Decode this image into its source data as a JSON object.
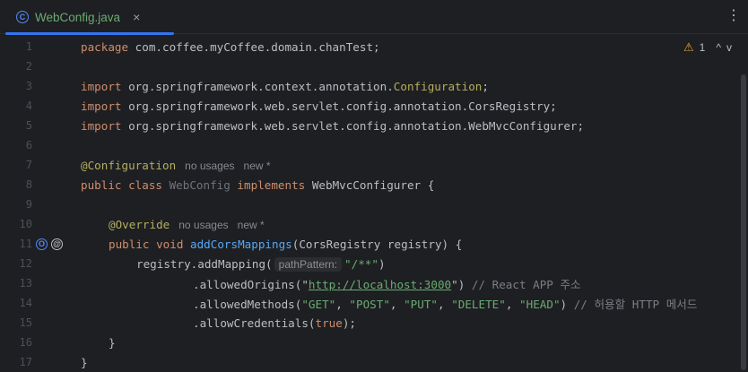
{
  "tab": {
    "title": "WebConfig.java",
    "close": "×",
    "class_icon": "C"
  },
  "menu": "⋮",
  "problems": {
    "count": "1",
    "warn_glyph": "⚠",
    "up": "^",
    "down": "v"
  },
  "lines": [
    {
      "n": "1"
    },
    {
      "n": "2"
    },
    {
      "n": "3"
    },
    {
      "n": "4"
    },
    {
      "n": "5"
    },
    {
      "n": "6"
    },
    {
      "n": "7"
    },
    {
      "n": "8"
    },
    {
      "n": "9"
    },
    {
      "n": "10"
    },
    {
      "n": "11"
    },
    {
      "n": "12"
    },
    {
      "n": "13"
    },
    {
      "n": "14"
    },
    {
      "n": "15"
    },
    {
      "n": "16"
    },
    {
      "n": "17"
    }
  ],
  "code": {
    "l1_kw": "package",
    "l1_rest": " com.coffee.myCoffee.domain.chanTest;",
    "l3_kw": "import",
    "l3_pkg": " org.springframework.context.annotation.",
    "l3_cls": "Configuration",
    "l3_end": ";",
    "l4_kw": "import",
    "l4_rest": " org.springframework.web.servlet.config.annotation.CorsRegistry;",
    "l5_kw": "import",
    "l5_rest": " org.springframework.web.servlet.config.annotation.WebMvcConfigurer;",
    "l7_ann": "@Configuration",
    "l7_hint1": "no usages",
    "l7_hint2": "new *",
    "l8_kw1": "public",
    "l8_kw2": " class",
    "l8_cls": " WebConfig",
    "l8_kw3": " implements",
    "l8_rest": " WebMvcConfigurer {",
    "l10_ann": "@Override",
    "l10_hint1": "no usages",
    "l10_hint2": "new *",
    "l11_kw1": "public",
    "l11_kw2": " void",
    "l11_method": " addCorsMappings",
    "l11_rest": "(CorsRegistry registry) {",
    "l12_pre": "registry.addMapping(",
    "l12_inlay": "pathPattern:",
    "l12_str": "\"/**\"",
    "l12_end": ")",
    "l13_pre": ".allowedOrigins(\"",
    "l13_link": "http://localhost:3000",
    "l13_post": "\")",
    "l13_cmt": " // React APP 주소",
    "l14_pre": ".allowedMethods(",
    "l14_s1": "\"GET\"",
    "l14_s2": "\"POST\"",
    "l14_s3": "\"PUT\"",
    "l14_s4": "\"DELETE\"",
    "l14_s5": "\"HEAD\"",
    "l14_sep": ", ",
    "l14_end": ")",
    "l14_cmt": " // 허용할 HTTP 메서드",
    "l15_pre": ".allowCredentials(",
    "l15_kw": "true",
    "l15_end": ");",
    "l16": "}",
    "l17": "}"
  },
  "gutter": {
    "override_glyph": "O",
    "at_glyph": "@"
  }
}
